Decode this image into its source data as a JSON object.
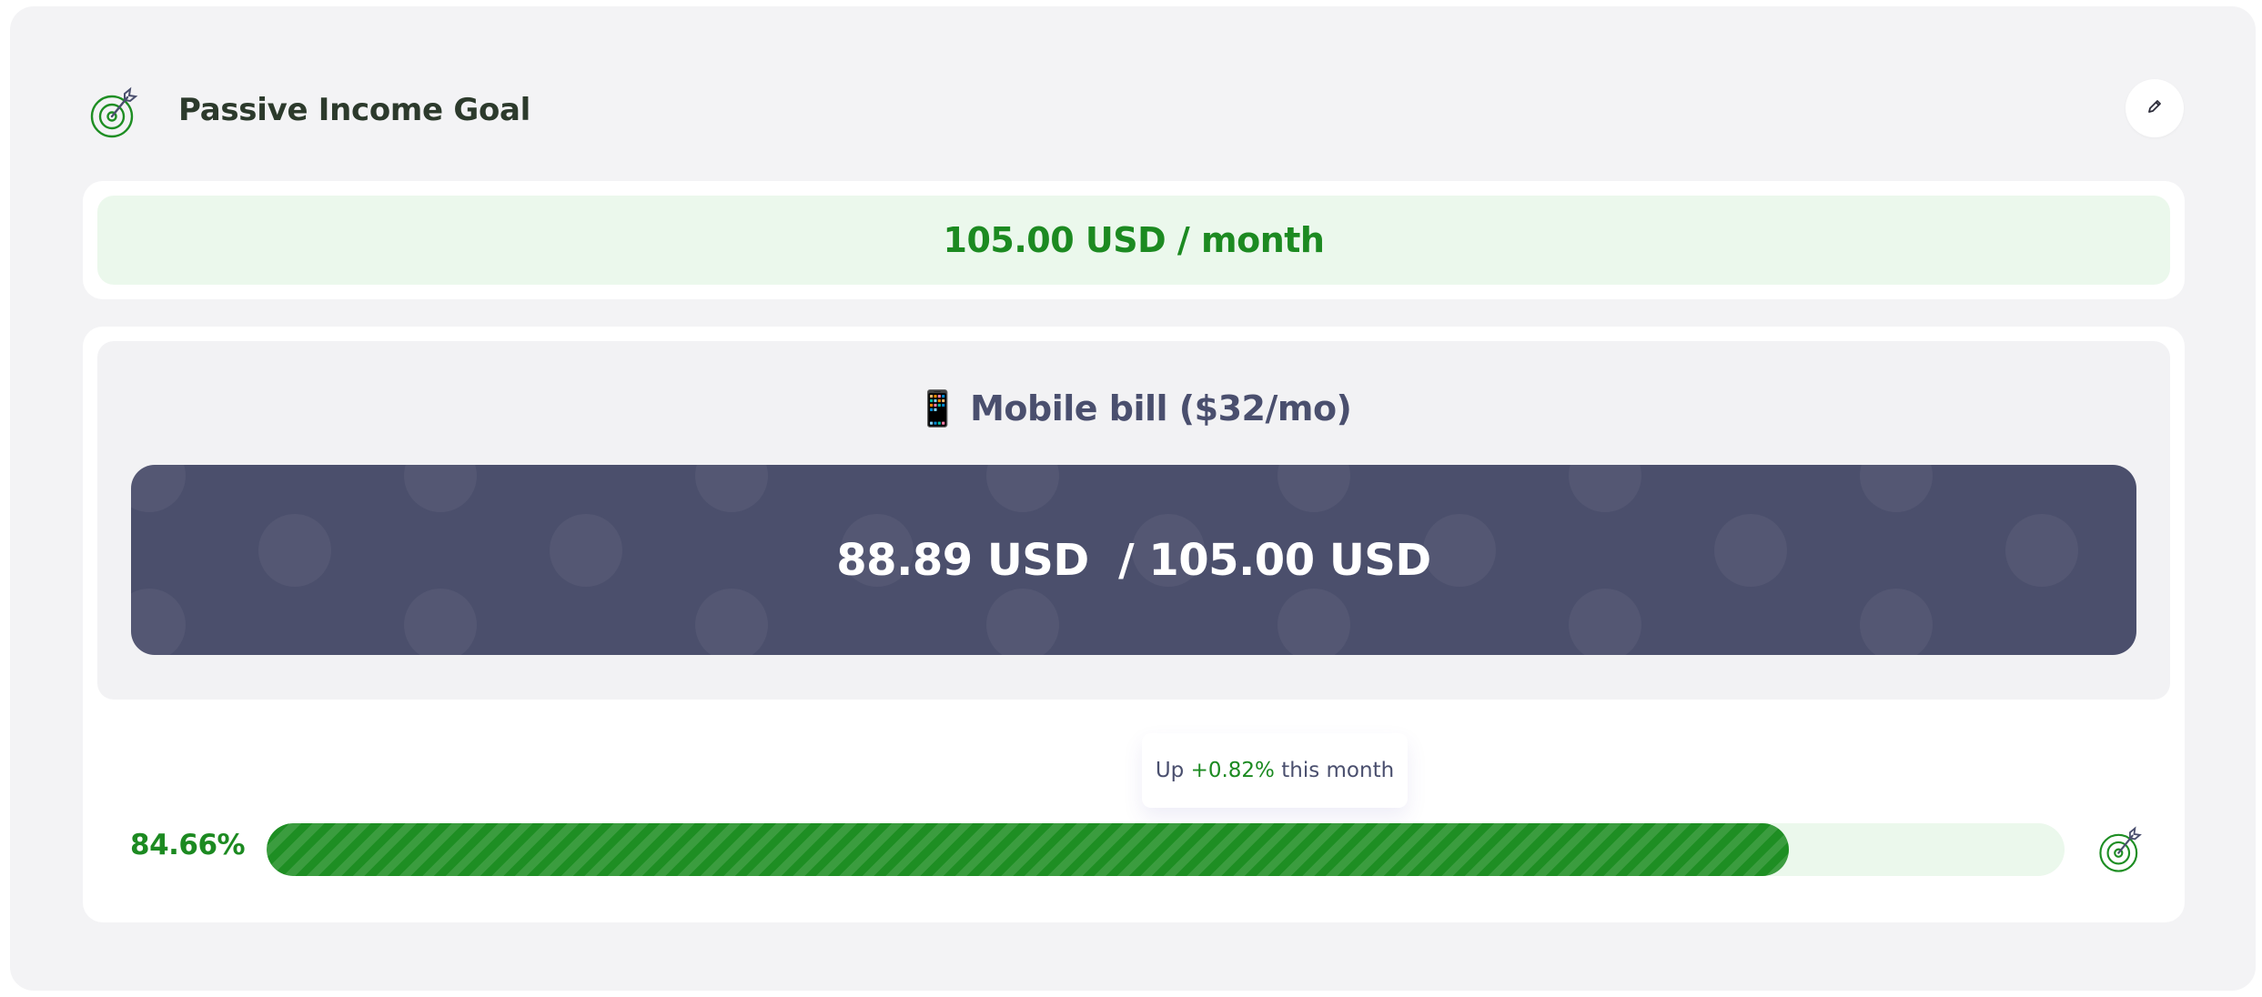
{
  "header": {
    "title": "Passive Income Goal",
    "goal_icon": "target-arrow-icon",
    "edit_icon": "pencil-icon"
  },
  "target": {
    "text": "105.00 USD / month"
  },
  "expense": {
    "title": "📱 Mobile bill ($32/mo)",
    "amount_text": "88.89 USD  / 105.00 USD"
  },
  "tooltip": {
    "prefix": "Up ",
    "change": "+0.82%",
    "suffix": " this month"
  },
  "progress": {
    "label": "84.66%",
    "value": 0.8466
  },
  "colors": {
    "accent_green": "#1c8a21",
    "amount_bg": "#4b4f6c",
    "light_green": "#ebf8ec"
  }
}
